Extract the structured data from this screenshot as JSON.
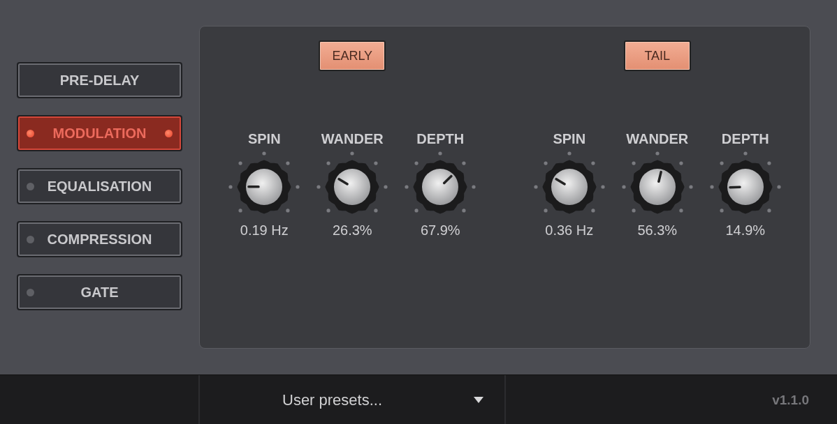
{
  "sections": [
    {
      "label": "PRE-DELAY",
      "kind": "plain",
      "selected": false
    },
    {
      "label": "MODULATION",
      "kind": "led",
      "selected": true
    },
    {
      "label": "EQUALISATION",
      "kind": "led",
      "selected": false
    },
    {
      "label": "COMPRESSION",
      "kind": "led",
      "selected": false
    },
    {
      "label": "GATE",
      "kind": "led",
      "selected": false
    }
  ],
  "groups": [
    {
      "button": {
        "label": "EARLY",
        "on": true
      },
      "knobs": [
        {
          "label": "SPIN",
          "value": "0.19 Hz",
          "level": 0.17
        },
        {
          "label": "WANDER",
          "value": "26.3%",
          "level": 0.28
        },
        {
          "label": "DEPTH",
          "value": "67.9%",
          "level": 0.67
        }
      ]
    },
    {
      "button": {
        "label": "TAIL",
        "on": true
      },
      "knobs": [
        {
          "label": "SPIN",
          "value": "0.36 Hz",
          "level": 0.28
        },
        {
          "label": "WANDER",
          "value": "56.3%",
          "level": 0.55
        },
        {
          "label": "DEPTH",
          "value": "14.9%",
          "level": 0.16
        }
      ]
    }
  ],
  "footer": {
    "preset": "User presets...",
    "version": "v1.1.0"
  }
}
